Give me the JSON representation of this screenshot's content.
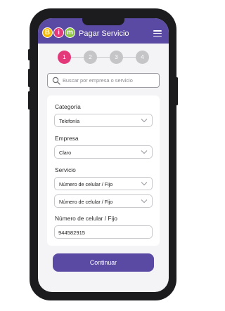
{
  "colors": {
    "brand": "#5b4aa3",
    "step_active": "#e3387a",
    "step_inactive": "#c5c5c8"
  },
  "header": {
    "logo": {
      "letters": [
        "B",
        "i",
        "m"
      ],
      "colors": [
        "#f5b800",
        "#e3387a",
        "#8cc63f"
      ]
    },
    "title": "Pagar Servicio",
    "menu_icon": "hamburger-icon"
  },
  "stepper": {
    "current": 1,
    "steps": [
      "1",
      "2",
      "3",
      "4"
    ]
  },
  "search": {
    "placeholder": "Buscar por empresa o servicio",
    "value": "",
    "icon": "search-icon"
  },
  "form": {
    "categoria": {
      "label": "Categoría",
      "value": "Telefonía"
    },
    "empresa": {
      "label": "Empresa",
      "value": "Claro"
    },
    "servicio": {
      "label": "Servicio",
      "value_1": "Número de celular / Fijo",
      "value_2": "Número de celular / Fijo"
    },
    "numero": {
      "label": "Número de celular / Fijo",
      "value": "944582915"
    }
  },
  "cta": {
    "label": "Continuar"
  }
}
